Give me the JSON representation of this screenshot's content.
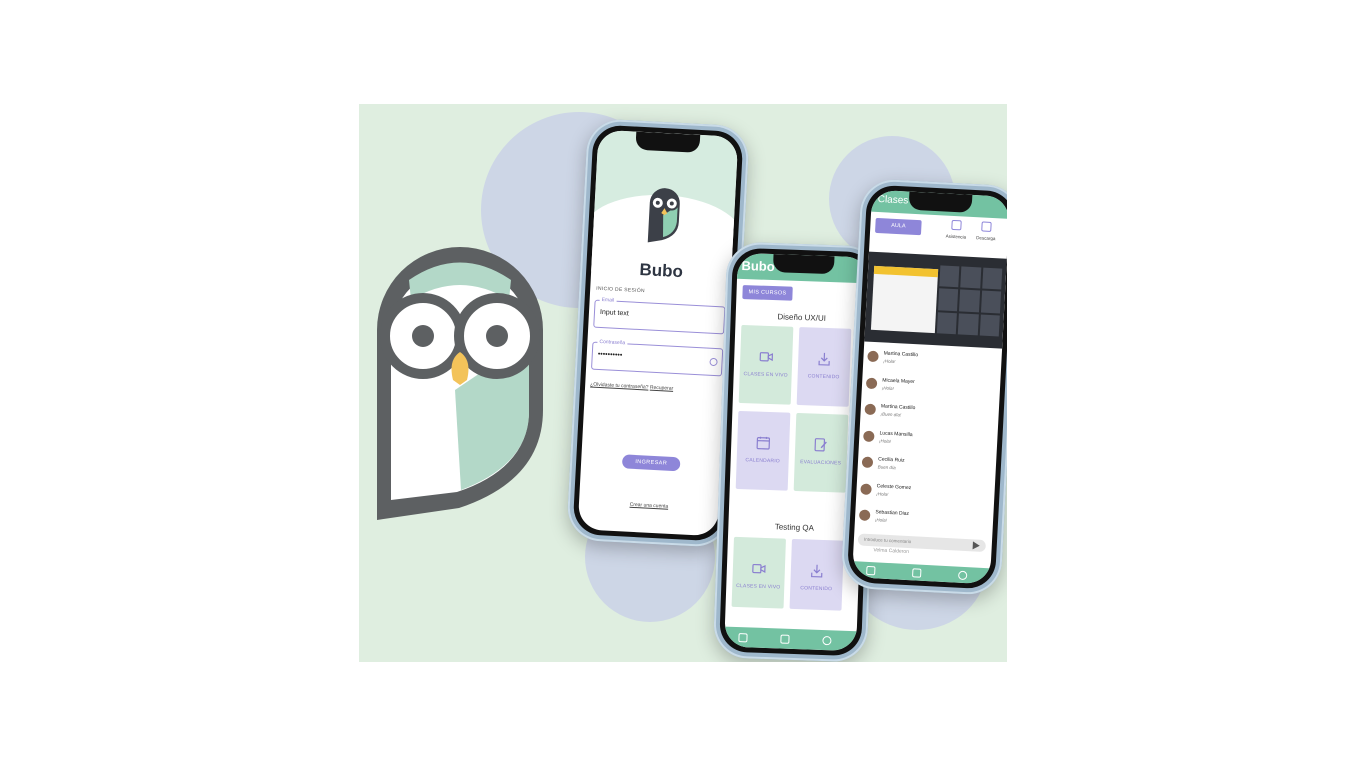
{
  "colors": {
    "background": "#dfeee0",
    "accent_purple": "#8e86d9",
    "accent_green": "#73c2a2",
    "owl_gray": "#5d6062",
    "owl_mint": "#b3d8c8"
  },
  "login": {
    "brand": "Bubo",
    "section_label": "INICIO DE SESIÓN",
    "email_label": "Email",
    "email_value": "Input text",
    "password_label": "Contraseña",
    "password_value": "••••••••••",
    "forgot_text": "¿Olvidaste tu contraseña?",
    "recover_link": "Recuperar",
    "submit_label": "INGRESAR",
    "create_account": "Crear una cuenta"
  },
  "courses": {
    "brand": "Bubo",
    "tab_label": "MIS CURSOS",
    "groups": [
      {
        "title": "Diseño UX/UI",
        "tiles": [
          {
            "label": "CLASES EN VIVO",
            "icon": "video-icon"
          },
          {
            "label": "CONTENIDO",
            "icon": "download-icon"
          },
          {
            "label": "CALENDARIO",
            "icon": "calendar-icon"
          },
          {
            "label": "EVALUACIONES",
            "icon": "edit-icon"
          }
        ]
      },
      {
        "title": "Testing QA",
        "tiles": [
          {
            "label": "CLASES EN VIVO",
            "icon": "video-icon"
          },
          {
            "label": "CONTENIDO",
            "icon": "download-icon"
          }
        ]
      }
    ]
  },
  "classes": {
    "title": "Clases",
    "aula_label": "AULA",
    "asistencia_label": "Asistencia",
    "descarga_label": "Descarga",
    "chat": [
      {
        "name": "Martina Castillo",
        "msg": "¡Hola!"
      },
      {
        "name": "Micaela Mayer",
        "msg": "¡Hola!"
      },
      {
        "name": "Martina Castillo",
        "msg": "¡Buen día!"
      },
      {
        "name": "Lucas Mansilla",
        "msg": "¡Hola!"
      },
      {
        "name": "Cecilia Ruiz",
        "msg": "Buen día"
      },
      {
        "name": "Celeste Gomez",
        "msg": "¡Hola!"
      },
      {
        "name": "Sebastian Diaz",
        "msg": "¡Hola!"
      }
    ],
    "comment_placeholder": "Introduce tu comentario",
    "last_peek": "Velma Calderon"
  }
}
